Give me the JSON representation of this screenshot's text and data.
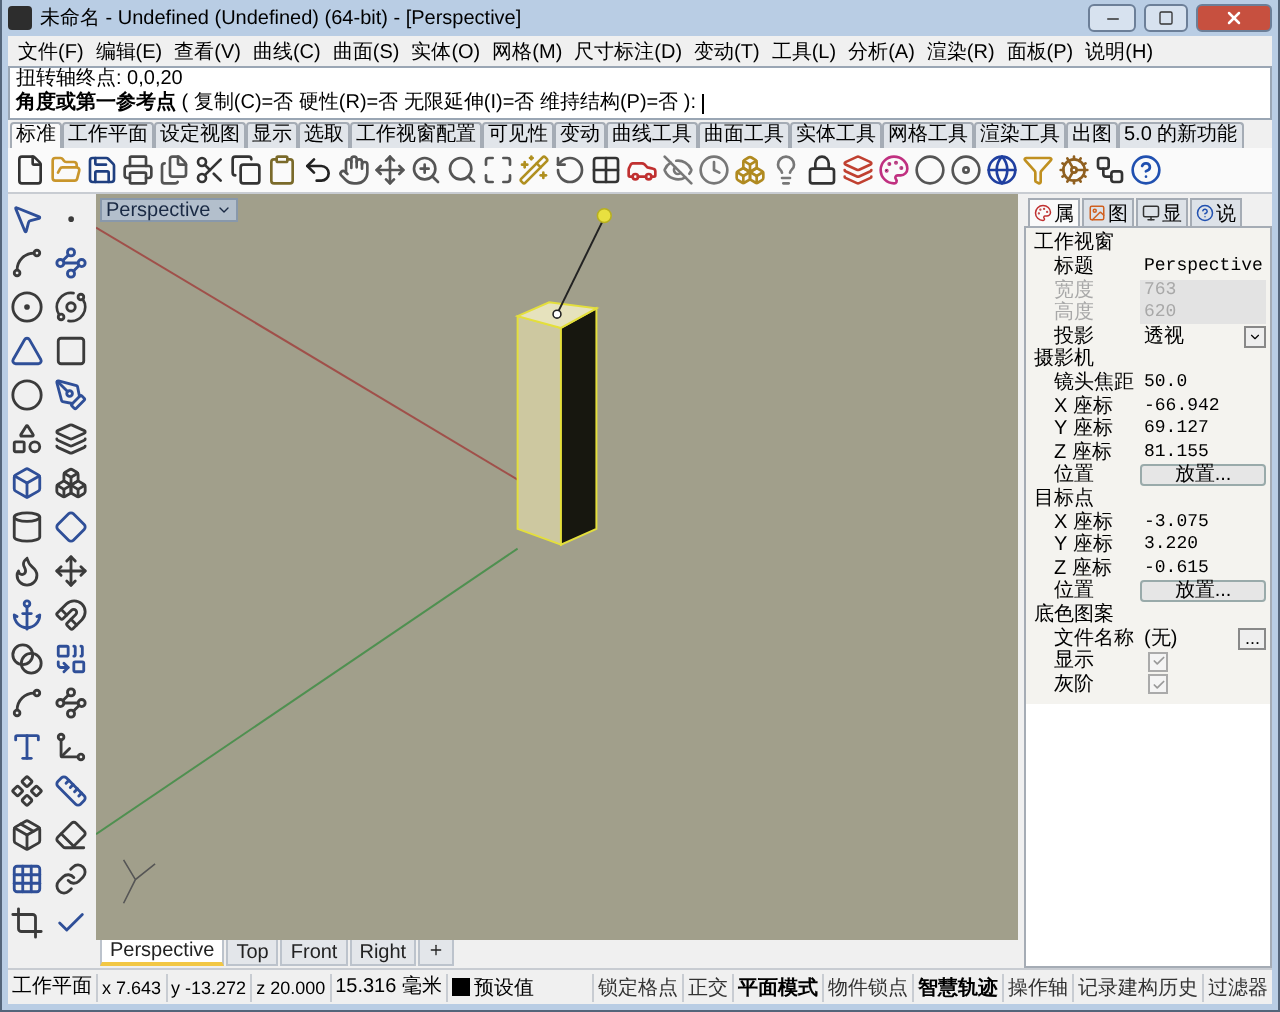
{
  "window": {
    "title": "未命名 - Undefined (Undefined) (64-bit) - [Perspective]"
  },
  "menu": [
    "文件(F)",
    "编辑(E)",
    "查看(V)",
    "曲线(C)",
    "曲面(S)",
    "实体(O)",
    "网格(M)",
    "尺寸标注(D)",
    "变动(T)",
    "工具(L)",
    "分析(A)",
    "渲染(R)",
    "面板(P)",
    "说明(H)"
  ],
  "command": {
    "history": "扭转轴终点: 0,0,20",
    "prompt": "**角度或第一参考点** ( 复制(C)=否  硬性(R)=否  无限延伸(I)=否  维持结构(P)=否 ):"
  },
  "toolbar_tabs": [
    {
      "label": "标准",
      "selected": true
    },
    {
      "label": "工作平面",
      "selected": false
    },
    {
      "label": "设定视图",
      "selected": false
    },
    {
      "label": "显示",
      "selected": false
    },
    {
      "label": "选取",
      "selected": false
    },
    {
      "label": "工作视窗配置",
      "selected": false
    },
    {
      "label": "可见性",
      "selected": false
    },
    {
      "label": "变动",
      "selected": false
    },
    {
      "label": "曲线工具",
      "selected": false
    },
    {
      "label": "曲面工具",
      "selected": false
    },
    {
      "label": "实体工具",
      "selected": false
    },
    {
      "label": "网格工具",
      "selected": false
    },
    {
      "label": "渲染工具",
      "selected": false
    },
    {
      "label": "出图",
      "selected": false
    },
    {
      "label": "5.0 的新功能",
      "selected": false
    }
  ],
  "viewport": {
    "title": "Perspective"
  },
  "viewport_tabs": [
    {
      "label": "Perspective",
      "selected": true
    },
    {
      "label": "Top",
      "selected": false
    },
    {
      "label": "Front",
      "selected": false
    },
    {
      "label": "Right",
      "selected": false
    }
  ],
  "panel": {
    "tabs": [
      {
        "label": "属",
        "selected": true
      },
      {
        "label": "图",
        "selected": false
      },
      {
        "label": "显",
        "selected": false
      },
      {
        "label": "说",
        "selected": false
      }
    ],
    "sections": [
      {
        "title": "工作视窗",
        "rows": [
          {
            "label": "标题",
            "value": "Perspective",
            "kind": "text"
          },
          {
            "label": "宽度",
            "value": "763",
            "kind": "disabled"
          },
          {
            "label": "高度",
            "value": "620",
            "kind": "disabled"
          },
          {
            "label": "投影",
            "value": "透视",
            "kind": "dropdown"
          }
        ]
      },
      {
        "title": "摄影机",
        "rows": [
          {
            "label": "镜头焦距",
            "value": "50.0",
            "kind": "text"
          },
          {
            "label": "X 座标",
            "value": "-66.942",
            "kind": "text"
          },
          {
            "label": "Y 座标",
            "value": "69.127",
            "kind": "text"
          },
          {
            "label": "Z 座标",
            "value": "81.155",
            "kind": "text"
          },
          {
            "label": "位置",
            "value": "放置...",
            "kind": "button"
          }
        ]
      },
      {
        "title": "目标点",
        "rows": [
          {
            "label": "X 座标",
            "value": "-3.075",
            "kind": "text"
          },
          {
            "label": "Y 座标",
            "value": "3.220",
            "kind": "text"
          },
          {
            "label": "Z 座标",
            "value": "-0.615",
            "kind": "text"
          },
          {
            "label": "位置",
            "value": "放置...",
            "kind": "button"
          }
        ]
      },
      {
        "title": "底色图案",
        "rows": [
          {
            "label": "文件名称",
            "value": "(无)",
            "kind": "browse",
            "button": "..."
          },
          {
            "label": "显示",
            "checked": true,
            "kind": "checkbox"
          },
          {
            "label": "灰阶",
            "checked": true,
            "kind": "checkbox"
          }
        ]
      }
    ]
  },
  "status_bar": {
    "plane": "工作平面",
    "x": "x 7.643",
    "y": "y -13.272",
    "z": "z 20.000",
    "units": "15.316 毫米",
    "layer": {
      "name": "预设值",
      "color": "#000000"
    },
    "toggles": [
      {
        "label": "锁定格点",
        "on": false
      },
      {
        "label": "正交",
        "on": false
      },
      {
        "label": "平面模式",
        "on": true
      },
      {
        "label": "物件锁点",
        "on": false
      },
      {
        "label": "智慧轨迹",
        "on": true
      },
      {
        "label": "操作轴",
        "on": false
      },
      {
        "label": "记录建构历史",
        "on": false
      },
      {
        "label": "过滤器",
        "on": false
      }
    ]
  }
}
